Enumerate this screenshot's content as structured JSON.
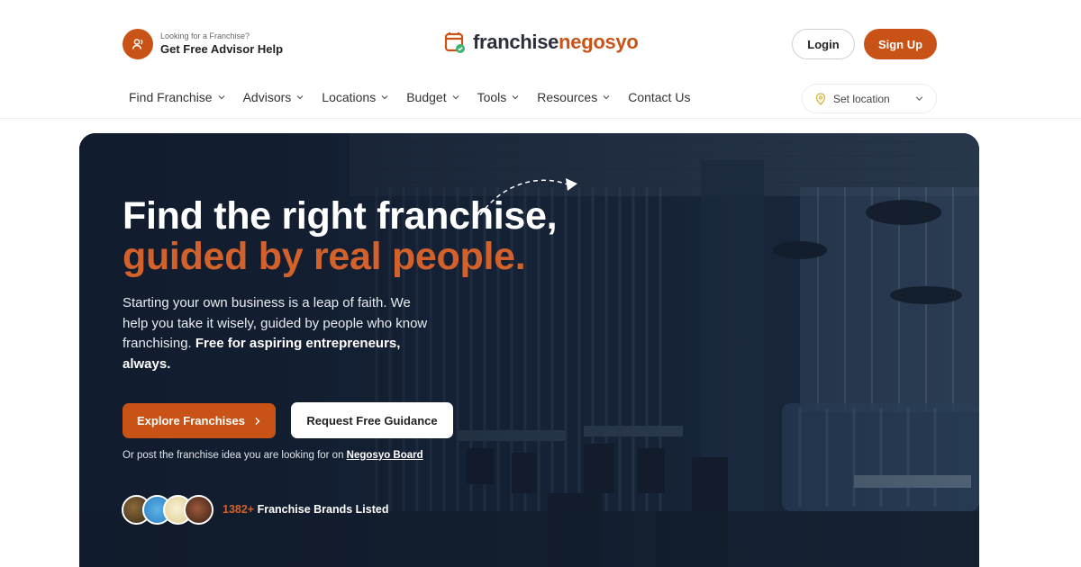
{
  "header": {
    "advisor": {
      "small_label": "Looking for a Franchise?",
      "big_label": "Get Free Advisor Help",
      "icon": "user-icon"
    },
    "logo": {
      "part1": "franchise",
      "part2": "negosyo",
      "icon": "store-check-icon"
    },
    "login_label": "Login",
    "signup_label": "Sign Up",
    "accent_color": "#c95317"
  },
  "nav": {
    "items": [
      {
        "label": "Find Franchise",
        "has_dropdown": true
      },
      {
        "label": "Advisors",
        "has_dropdown": true
      },
      {
        "label": "Locations",
        "has_dropdown": true
      },
      {
        "label": "Budget",
        "has_dropdown": true
      },
      {
        "label": "Tools",
        "has_dropdown": true
      },
      {
        "label": "Resources",
        "has_dropdown": true
      },
      {
        "label": "Contact Us",
        "has_dropdown": false
      }
    ],
    "location_placeholder": "Set location"
  },
  "hero": {
    "title_line1": "Find the right franchise,",
    "title_line2": "guided by real people.",
    "description_plain": "Starting your own business is a leap of faith. We help you take it wisely, guided by people who know franchising. ",
    "description_bold": "Free for aspiring entrepreneurs, always.",
    "explore_label": "Explore Franchises",
    "request_label": "Request Free Guidance",
    "board_text": "Or post the franchise idea you are looking for on ",
    "board_link": "Negosyo Board",
    "brands_count": "1382+",
    "brands_label": "Franchise Brands Listed",
    "highlight_color": "#d2612b"
  }
}
